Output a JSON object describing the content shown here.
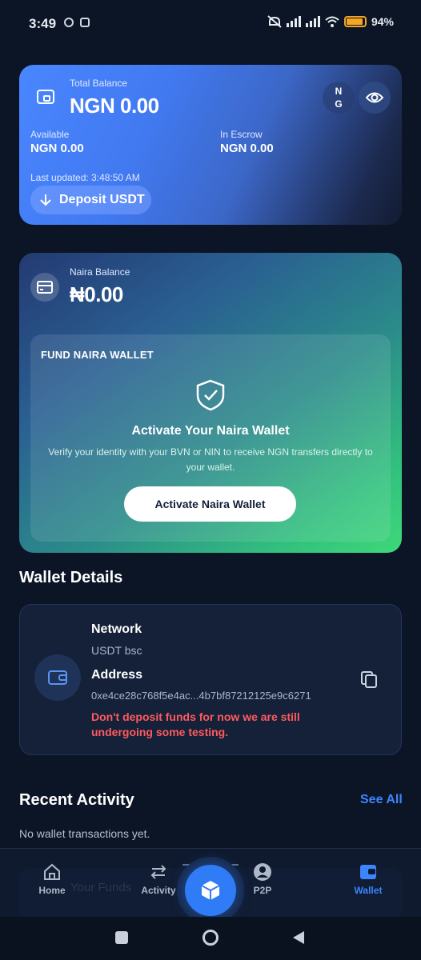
{
  "status_bar": {
    "time": "3:49",
    "battery": "94%"
  },
  "total_balance": {
    "label": "Total Balance",
    "amount": "NGN 0.00",
    "currency_badge_line1": "N",
    "currency_badge_line2": "G",
    "available_label": "Available",
    "available_value": "NGN 0.00",
    "escrow_label": "In Escrow",
    "escrow_value": "NGN 0.00",
    "last_updated": "Last updated: 3:48:50 AM",
    "deposit_button": "Deposit USDT"
  },
  "naira": {
    "label": "Naira Balance",
    "amount": "₦0.00",
    "fund_title": "FUND NAIRA WALLET",
    "activate_title": "Activate Your Naira Wallet",
    "activate_desc": "Verify your identity with your BVN or NIN to receive NGN transfers directly to your wallet.",
    "activate_button": "Activate Naira Wallet"
  },
  "wallet_details": {
    "title": "Wallet Details",
    "network_label": "Network",
    "network_value": "USDT bsc",
    "address_label": "Address",
    "address_value": "0xe4ce28c768f5e4ac...4b7bf87212125e9c6271",
    "warning": "Don't deposit funds for now we are still undergoing some testing."
  },
  "recent_activity": {
    "title": "Recent Activity",
    "see_all": "See All",
    "empty": "No wallet transactions yet."
  },
  "ghost_banner": {
    "title": "Your Funds"
  },
  "nav": {
    "home": "Home",
    "activity": "Activity",
    "p2p": "P2P",
    "wallet": "Wallet"
  },
  "colors": {
    "accent": "#3d84ff",
    "warning": "#ff5a5f",
    "background": "#0c1526"
  }
}
